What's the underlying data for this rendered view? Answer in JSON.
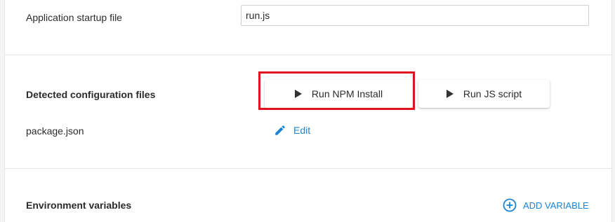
{
  "startup": {
    "label": "Application startup file",
    "value": "run.js"
  },
  "config": {
    "heading": "Detected configuration files",
    "npm_button_label": "Run NPM Install",
    "js_button_label": "Run JS script",
    "file_name": "package.json",
    "edit_label": "Edit"
  },
  "env": {
    "heading": "Environment variables",
    "add_label": "ADD VARIABLE"
  },
  "colors": {
    "accent": "#1a83d6",
    "highlight": "#e0141e"
  },
  "icons": {
    "play": "play-icon",
    "edit": "pencil-icon",
    "add": "plus-circle-icon"
  }
}
